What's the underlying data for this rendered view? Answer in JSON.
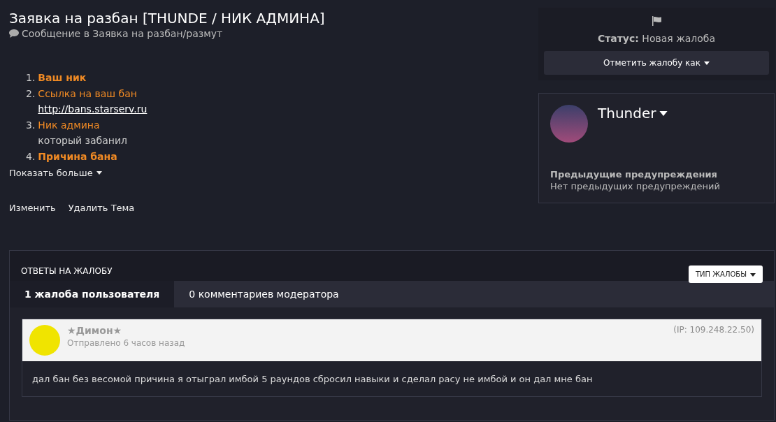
{
  "title": "Заявка на разбан [THUNDE / НИК АДМИНА]",
  "subtitle": "Сообщение в Заявка на разбан/размут",
  "list": [
    {
      "number": "1.",
      "label": "Ваш ник",
      "bold": true
    },
    {
      "number": "2.",
      "label": "Ссылка на ваш бан",
      "bold": false,
      "note": "http://bans.starserv.ru",
      "kind": "link"
    },
    {
      "number": "3.",
      "label": "Ник админа",
      "bold": false,
      "note": "который забанил",
      "kind": "text"
    },
    {
      "number": "4.",
      "label": "Причина бана",
      "bold": true
    }
  ],
  "show_more": "Показать больше",
  "actions": [
    "Изменить",
    "Удалить Тема"
  ],
  "status": {
    "label": "Статус:",
    "value": "Новая жалоба",
    "button": "Отметить жалобу как"
  },
  "user": {
    "name": "Thunder",
    "warnings_title": "Предыдущие предупреждения",
    "warnings_text": "Нет предыдущих предупреждений"
  },
  "responses": {
    "title": "ОТВЕТЫ НА ЖАЛОБУ",
    "filter_button": "ТИП ЖАЛОБЫ",
    "tabs": [
      {
        "label": "1 жалоба пользователя",
        "selected": true
      },
      {
        "label": "0 комментариев модератора",
        "selected": false
      }
    ],
    "report": {
      "author": "★Димон★",
      "time": "Отправлено 6 часов назад",
      "ip": "(IP: 109.248.22.50)",
      "text": "дал бан без весомой причина я отыграл имбой 5 раундов сбросил навыки и сделал расу не имбой и он дал мне бан"
    }
  }
}
